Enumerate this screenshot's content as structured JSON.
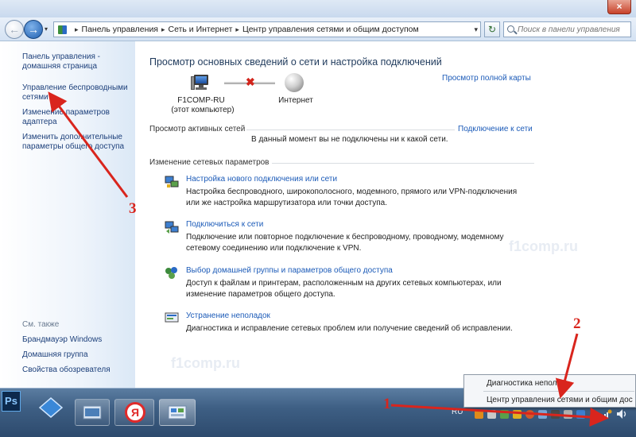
{
  "window": {
    "close_glyph": "×"
  },
  "address_bar": {
    "back_glyph": "←",
    "forward_glyph": "→",
    "dropdown_glyph": "▾",
    "refresh_glyph": "↻",
    "crumb_separator": "▸",
    "breadcrumbs": [
      "Панель управления",
      "Сеть и Интернет",
      "Центр управления сетями и общим доступом"
    ],
    "search_placeholder": "Поиск в панели управления"
  },
  "sidebar": {
    "items": [
      {
        "label": "Панель управления - домашняя страница"
      },
      {
        "label": "Управление беспроводными сетями"
      },
      {
        "label": "Изменение параметров адаптера"
      },
      {
        "label": "Изменить дополнительные параметры общего доступа"
      }
    ],
    "see_also_label": "См. также",
    "see_also": [
      {
        "label": "Брандмауэр Windows"
      },
      {
        "label": "Домашняя группа"
      },
      {
        "label": "Свойства обозревателя"
      }
    ]
  },
  "main": {
    "heading": "Просмотр основных сведений о сети и настройка подключений",
    "full_map_link": "Просмотр полной карты",
    "map": {
      "computer_name": "F1COMP-RU",
      "computer_sub": "(этот компьютер)",
      "internet_label": "Интернет",
      "disconnected_glyph": "✖"
    },
    "active_networks": {
      "title": "Просмотр активных сетей",
      "connect_link": "Подключение к сети",
      "status": "В данный момент вы не подключены ни к какой сети."
    },
    "change_settings": {
      "title": "Изменение сетевых параметров",
      "tasks": [
        {
          "link": "Настройка нового подключения или сети",
          "desc": "Настройка беспроводного, широкополосного, модемного, прямого или VPN-подключения или же настройка маршрутизатора или точки доступа.",
          "icon": "network-setup-icon"
        },
        {
          "link": "Подключиться к сети",
          "desc": "Подключение или повторное подключение к беспроводному, проводному, модемному сетевому соединению или подключение к VPN.",
          "icon": "connect-network-icon"
        },
        {
          "link": "Выбор домашней группы и параметров общего доступа",
          "desc": "Доступ к файлам и принтерам, расположенным на других сетевых компьютерах, или изменение параметров общего доступа.",
          "icon": "homegroup-icon"
        },
        {
          "link": "Устранение неполадок",
          "desc": "Диагностика и исправление сетевых проблем или получение сведений об исправлении.",
          "icon": "troubleshoot-icon"
        }
      ]
    }
  },
  "watermark": {
    "text": "f1comp.ru"
  },
  "popup_menu": {
    "items": [
      "Диагностика непола",
      "Центр управления сетями и общим дос"
    ]
  },
  "taskbar": {
    "ps_label": "Ps",
    "yandex_label": "Я",
    "lang": "RU"
  },
  "annotations": [
    "1",
    "2",
    "3"
  ],
  "colors": {
    "link": "#1c5bb8",
    "annotation": "#d9251d",
    "taskbar": "#3e5f84"
  }
}
